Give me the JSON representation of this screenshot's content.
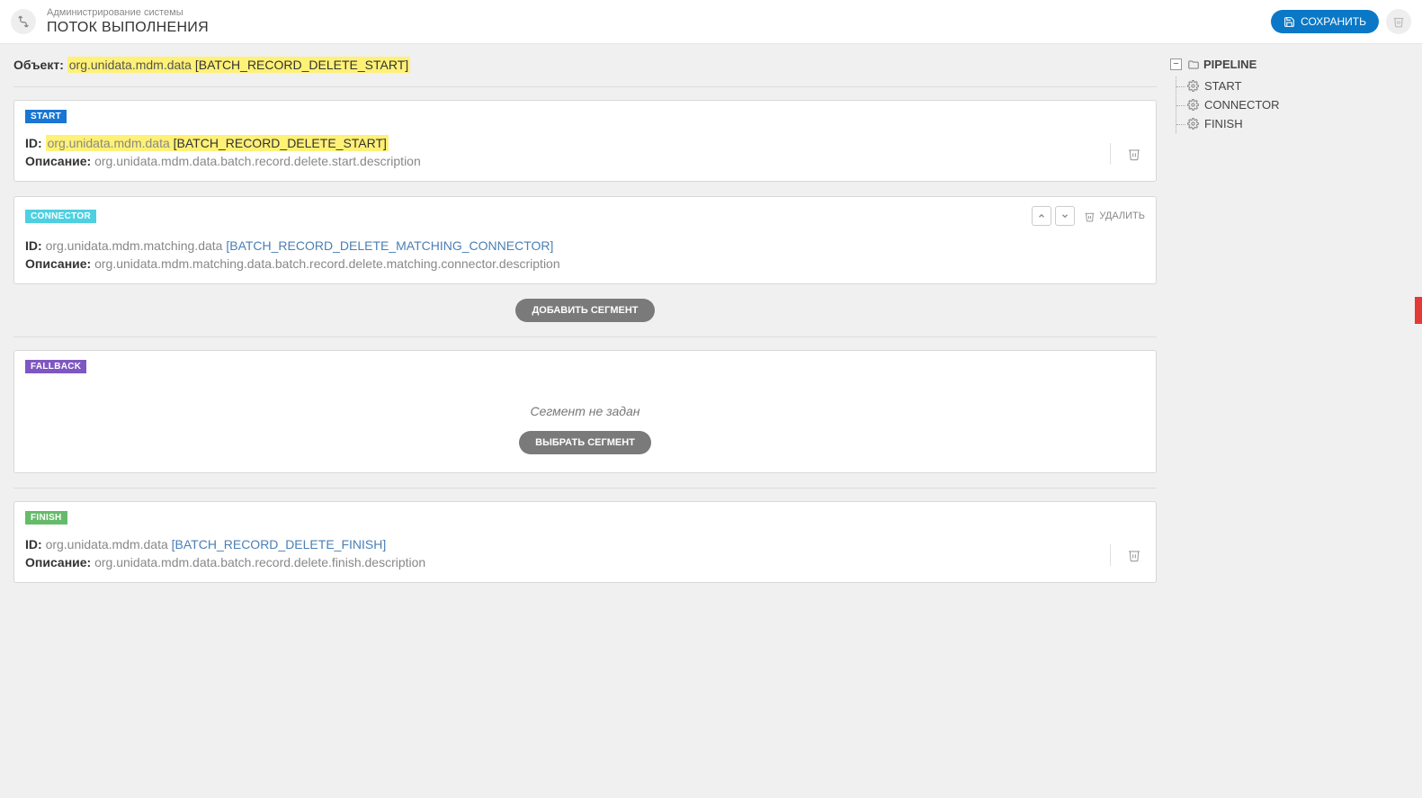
{
  "header": {
    "subtitle": "Администрирование системы",
    "title": "ПОТОК ВЫПОЛНЕНИЯ",
    "save_label": "СОХРАНИТЬ"
  },
  "object": {
    "label": "Объект:",
    "ns": "org.unidata.mdm.data",
    "code": "[BATCH_RECORD_DELETE_START]"
  },
  "labels": {
    "id": "ID:",
    "description": "Описание:",
    "add_segment": "ДОБАВИТЬ СЕГМЕНТ",
    "choose_segment": "ВЫБРАТЬ СЕГМЕНТ",
    "delete": "УДАЛИТЬ",
    "not_set": "Сегмент не задан"
  },
  "segments": {
    "start": {
      "tag": "START",
      "id_ns": "org.unidata.mdm.data ",
      "id_code": "[BATCH_RECORD_DELETE_START]",
      "description": "org.unidata.mdm.data.batch.record.delete.start.description"
    },
    "connector": {
      "tag": "CONNECTOR",
      "id_ns": "org.unidata.mdm.matching.data ",
      "id_code": "[BATCH_RECORD_DELETE_MATCHING_CONNECTOR]",
      "description": "org.unidata.mdm.matching.data.batch.record.delete.matching.connector.description"
    },
    "fallback": {
      "tag": "FALLBACK"
    },
    "finish": {
      "tag": "FINISH",
      "id_ns": "org.unidata.mdm.data ",
      "id_code": "[BATCH_RECORD_DELETE_FINISH]",
      "description": "org.unidata.mdm.data.batch.record.delete.finish.description"
    }
  },
  "tree": {
    "root": "PIPELINE",
    "items": [
      "START",
      "CONNECTOR",
      "FINISH"
    ]
  }
}
